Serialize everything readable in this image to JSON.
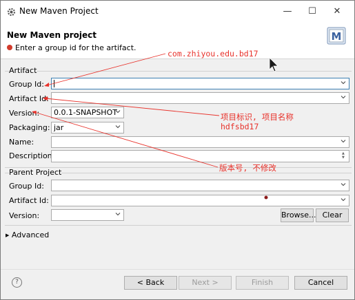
{
  "window": {
    "title": "New Maven Project",
    "icon": "gear-icon"
  },
  "header": {
    "title": "New Maven project",
    "message": "Enter a group id for the artifact.",
    "logo_text": "M"
  },
  "artifact": {
    "section_title": "Artifact",
    "group_id_label": "Group Id:",
    "group_id_value": "",
    "artifact_id_label": "Artifact Id:",
    "artifact_id_value": "",
    "version_label": "Version:",
    "version_value": "0.0.1-SNAPSHOT",
    "packaging_label": "Packaging:",
    "packaging_value": "jar",
    "name_label": "Name:",
    "name_value": "",
    "description_label": "Description:",
    "description_value": ""
  },
  "parent": {
    "section_title": "Parent Project",
    "group_id_label": "Group Id:",
    "artifact_id_label": "Artifact Id:",
    "version_label": "Version:",
    "browse_label": "Browse...",
    "clear_label": "Clear"
  },
  "advanced_label": "Advanced",
  "footer": {
    "help_label": "?",
    "back_label": "< Back",
    "next_label": "Next >",
    "finish_label": "Finish",
    "cancel_label": "Cancel"
  },
  "annotations": {
    "group_note": "com.zhiyou.edu.bd17",
    "artifact_note_1": "项目标识, 项目名称",
    "artifact_note_2": "hdfsbd17",
    "version_note": "版本号, 不修改"
  },
  "colors": {
    "annotation": "#e8312a",
    "accent": "#3c7fb1"
  }
}
